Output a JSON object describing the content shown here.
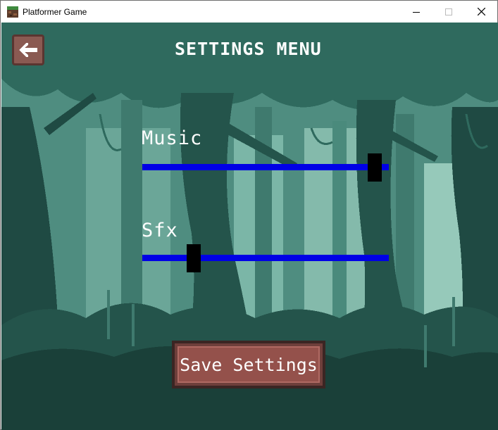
{
  "window": {
    "title": "Platformer Game",
    "icons": [
      "app-icon",
      "minimize-icon",
      "maximize-icon",
      "close-icon"
    ]
  },
  "header": {
    "title": "SETTINGS MENU",
    "back_icon": "arrow-left-icon"
  },
  "settings": {
    "music": {
      "label": "Music",
      "level": 0.97
    },
    "sfx": {
      "label": "Sfx",
      "level": 0.19
    }
  },
  "footer": {
    "save_label": "Save Settings"
  },
  "colors": {
    "slider_track": "#0000e6",
    "slider_handle": "#000000",
    "button_fill": "#94514b",
    "button_border": "#3b2523",
    "text": "#ffffff",
    "forest_dark": "#1f4a43",
    "forest_mid": "#3f7a6e",
    "forest_light": "#a8d8c8"
  }
}
